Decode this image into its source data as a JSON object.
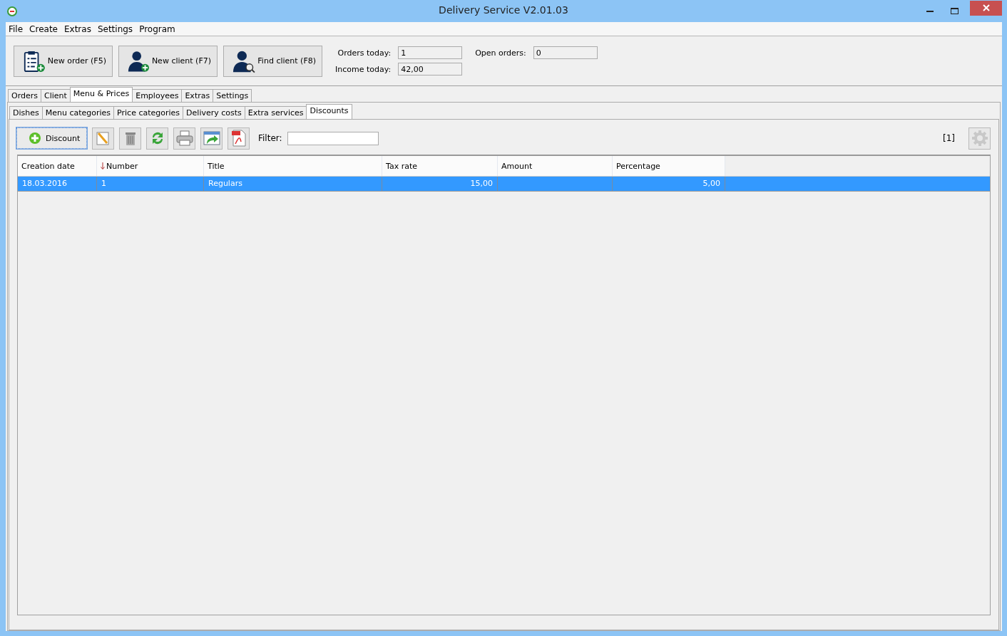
{
  "window": {
    "title": "Delivery Service V2.01.03"
  },
  "menu": [
    "File",
    "Create",
    "Extras",
    "Settings",
    "Program"
  ],
  "actions": [
    {
      "label": "New order (F5)",
      "kind": "order"
    },
    {
      "label": "New client (F7)",
      "kind": "client"
    },
    {
      "label": "Find client (F8)",
      "kind": "find"
    }
  ],
  "stats": [
    {
      "label": "Orders today:",
      "value": "1"
    },
    {
      "label": "Open orders:",
      "value": "0"
    },
    {
      "label": "Income today:",
      "value": "42,00"
    }
  ],
  "tabs": [
    {
      "label": "Orders",
      "selected": false
    },
    {
      "label": "Client",
      "selected": false
    },
    {
      "label": "Menu & Prices",
      "selected": true
    },
    {
      "label": "Employees",
      "selected": false
    },
    {
      "label": "Extras",
      "selected": false
    },
    {
      "label": "Settings",
      "selected": false
    }
  ],
  "subtabs": [
    {
      "label": "Dishes",
      "selected": false
    },
    {
      "label": "Menu categories",
      "selected": false
    },
    {
      "label": "Price categories",
      "selected": false
    },
    {
      "label": "Delivery costs",
      "selected": false
    },
    {
      "label": "Extra services",
      "selected": false
    },
    {
      "label": "Discounts",
      "selected": true
    }
  ],
  "toolbar": {
    "add_button": "Discount",
    "tools": [
      {
        "kind": "edit"
      },
      {
        "kind": "delete"
      },
      {
        "kind": "refresh"
      },
      {
        "kind": "print"
      },
      {
        "kind": "export"
      },
      {
        "kind": "pdf"
      }
    ],
    "filter_label": "Filter:",
    "count": "[1]"
  },
  "table": {
    "columns": [
      {
        "label": "Creation date",
        "sorted": false
      },
      {
        "label": "Number",
        "sorted": true
      },
      {
        "label": "Title",
        "sorted": false
      },
      {
        "label": "Tax rate",
        "sorted": false
      },
      {
        "label": "Amount",
        "sorted": false
      },
      {
        "label": "Percentage",
        "sorted": false
      }
    ],
    "rows": [
      {
        "selected": true,
        "cells": [
          "18.03.2016",
          "1",
          "Regulars",
          "15,00",
          "",
          "5,00"
        ]
      }
    ]
  }
}
